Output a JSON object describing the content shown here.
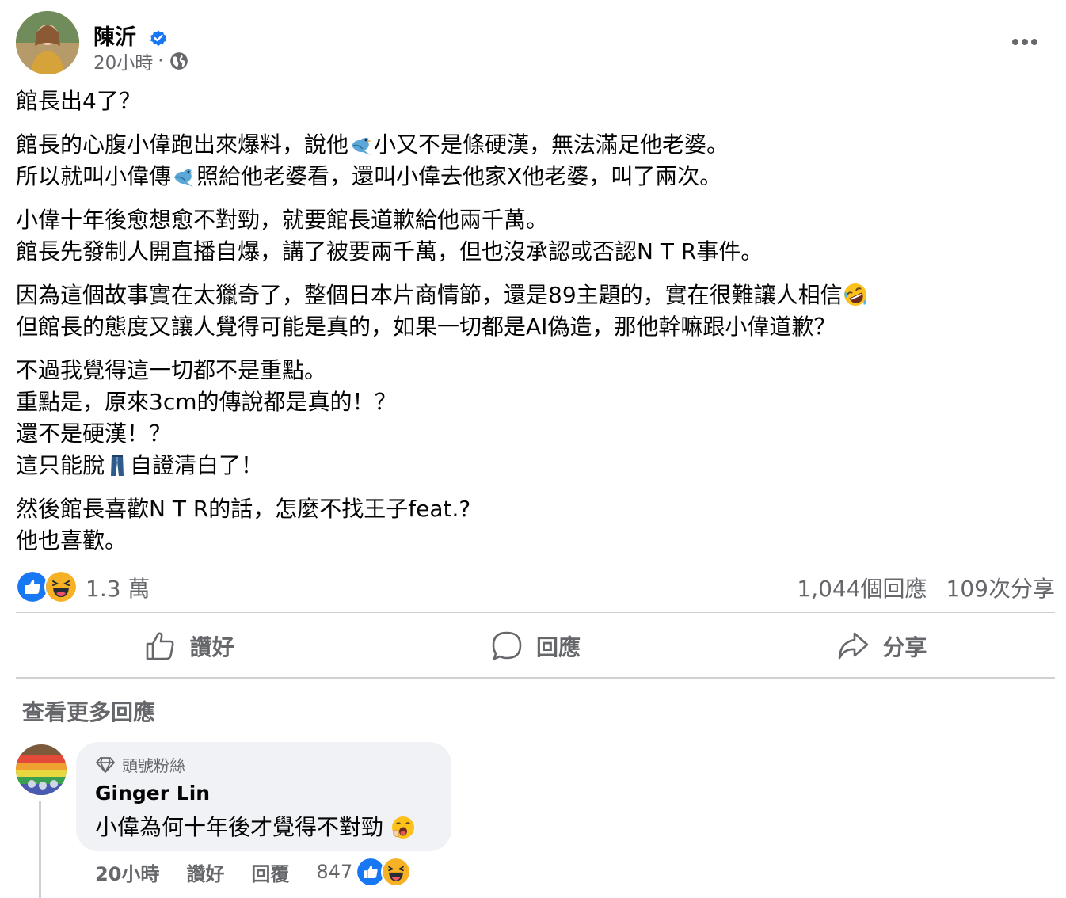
{
  "post": {
    "author": "陳沂",
    "time": "20小時",
    "separator": "·",
    "paragraphs": [
      {
        "lines": [
          [
            "館長出4了？"
          ]
        ]
      },
      {
        "lines": [
          [
            "館長的心腹小偉跑出來爆料，說他",
            "bird",
            "小又不是條硬漢，無法滿足他老婆。"
          ],
          [
            "所以就叫小偉傳",
            "bird",
            "照給他老婆看，還叫小偉去他家X他老婆，叫了兩次。"
          ]
        ]
      },
      {
        "lines": [
          [
            "小偉十年後愈想愈不對勁，就要館長道歉給他兩千萬。"
          ],
          [
            "館長先發制人開直播自爆，講了被要兩千萬，但也沒承認或否認N T R事件。"
          ]
        ]
      },
      {
        "lines": [
          [
            "因為這個故事實在太獵奇了，整個日本片商情節，還是89主題的，實在很難讓人相信",
            "rofl"
          ],
          [
            "但館長的態度又讓人覺得可能是真的，如果一切都是AI偽造，那他幹嘛跟小偉道歉？"
          ]
        ]
      },
      {
        "lines": [
          [
            "不過我覺得這一切都不是重點。"
          ],
          [
            "重點是，原來3cm的傳說都是真的！？"
          ],
          [
            "還不是硬漢！？"
          ],
          [
            "這只能脫",
            "jeans",
            "自證清白了！"
          ]
        ]
      },
      {
        "lines": [
          [
            "然後館長喜歡N T R的話，怎麼不找王子feat.?"
          ],
          [
            "他也喜歡。"
          ]
        ]
      }
    ]
  },
  "reactions": {
    "count": "1.3 萬",
    "comments": "1,044個回應",
    "shares": "109次分享"
  },
  "actions": {
    "like": "讚好",
    "comment": "回應",
    "share": "分享"
  },
  "more_comments": "查看更多回應",
  "comment": {
    "badge": "頭號粉絲",
    "name": "Ginger Lin",
    "text": "小偉為何十年後才覺得不對勁",
    "time": "20小時",
    "like": "讚好",
    "reply": "回覆",
    "reaction_count": "847"
  },
  "colors": {
    "facebook_blue": "#1877f2",
    "secondary_text": "#65676b",
    "bubble_bg": "#f0f2f5"
  }
}
